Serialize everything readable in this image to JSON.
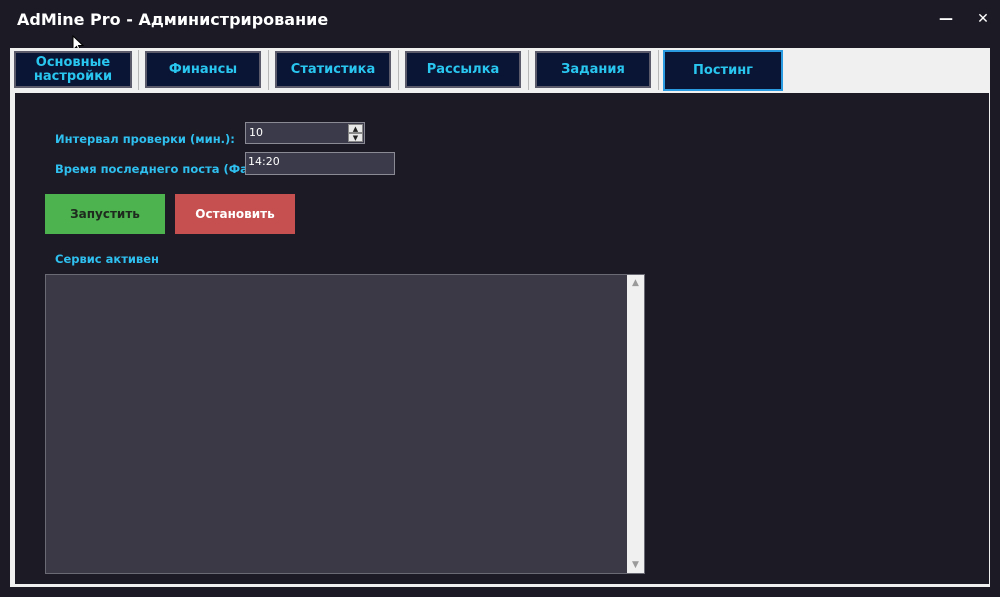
{
  "window": {
    "title": "AdMine Pro - Администрирование",
    "minimize_glyph": "—",
    "close_glyph": "✕"
  },
  "tabs": [
    {
      "label": "Основные настройки",
      "active": false
    },
    {
      "label": "Финансы",
      "active": false
    },
    {
      "label": "Статистика",
      "active": false
    },
    {
      "label": "Рассылка",
      "active": false
    },
    {
      "label": "Задания",
      "active": false
    },
    {
      "label": "Постинг",
      "active": true
    }
  ],
  "posting": {
    "interval_label": "Интервал проверки (мин.):",
    "interval_value": "10",
    "last_post_label": "Время последнего поста (Файл):",
    "last_post_value": "14:20",
    "start_button": "Запустить",
    "stop_button": "Остановить",
    "status_text": "Сервис активен",
    "log_text": ""
  },
  "colors": {
    "background": "#1b1a25",
    "accent_text": "#2fc0f0",
    "tab_background": "#0a1535",
    "start_button": "#4cb34e",
    "stop_button": "#c65050"
  }
}
